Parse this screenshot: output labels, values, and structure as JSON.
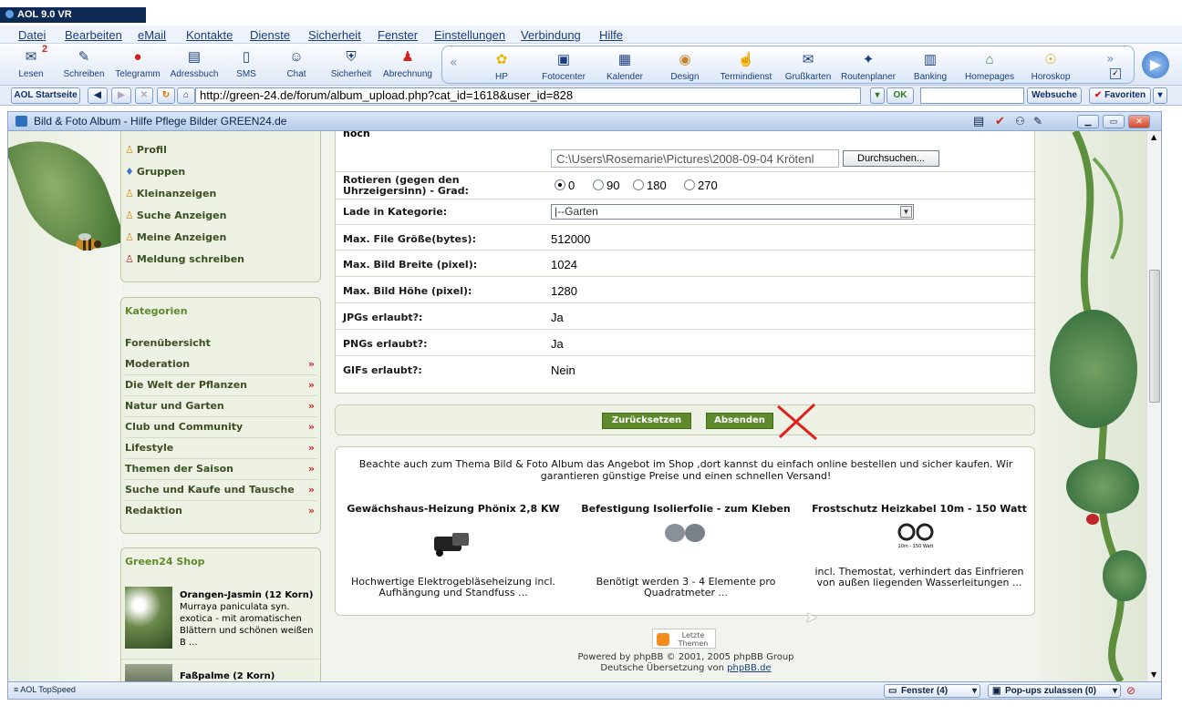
{
  "app_title": "AOL 9.0 VR",
  "menu": [
    "Datei",
    "Bearbeiten",
    "eMail",
    "Kontakte",
    "Dienste",
    "Sicherheit",
    "Fenster",
    "Einstellungen",
    "Verbindung",
    "Hilfe"
  ],
  "mail_badge": "2",
  "toolbar_left": [
    {
      "label": "Lesen",
      "icon": "mail-read-icon"
    },
    {
      "label": "Schreiben",
      "icon": "write-icon"
    },
    {
      "label": "Telegramm",
      "icon": "aim-icon"
    },
    {
      "label": "Adressbuch",
      "icon": "addressbook-icon"
    },
    {
      "label": "SMS",
      "icon": "phone-icon"
    },
    {
      "label": "Chat",
      "icon": "chat-icon"
    },
    {
      "label": "Sicherheit",
      "icon": "shield-icon"
    },
    {
      "label": "Abrechnung",
      "icon": "billing-icon"
    }
  ],
  "toolbar_right": [
    {
      "label": "HP",
      "icon": "flower-icon"
    },
    {
      "label": "Fotocenter",
      "icon": "photo-icon"
    },
    {
      "label": "Kalender",
      "icon": "calendar-icon"
    },
    {
      "label": "Design",
      "icon": "palette-icon"
    },
    {
      "label": "Termindienst",
      "icon": "hand-icon"
    },
    {
      "label": "Grußkarten",
      "icon": "card-icon"
    },
    {
      "label": "Routenplaner",
      "icon": "compass-icon"
    },
    {
      "label": "Banking",
      "icon": "bank-icon"
    },
    {
      "label": "Homepages",
      "icon": "house-icon"
    },
    {
      "label": "Horoskop",
      "icon": "horoscope-icon"
    }
  ],
  "address": {
    "home_label": "AOL Startseite",
    "url": "http://green-24.de/forum/album_upload.php?cat_id=1618&user_id=828",
    "ok_label": "OK",
    "search_label": "Websuche",
    "favorites_label": "Favoriten"
  },
  "window_title": "Bild & Foto Album - Hilfe Pflege Bilder GREEN24.de",
  "sidebar_top": [
    "Profil",
    "Gruppen",
    "Kleinanzeigen",
    "Suche Anzeigen",
    "Meine Anzeigen",
    "Meldung schreiben"
  ],
  "categories": {
    "heading": "Kategorien",
    "overview": "Forenübersicht",
    "items": [
      "Moderation",
      "Die Welt der Pflanzen",
      "Natur und Garten",
      "Club und Community",
      "Lifestyle",
      "Themen der Saison",
      "Suche und Kaufe und Tausche",
      "Redaktion"
    ]
  },
  "shop": {
    "heading": "Green24 Shop",
    "item1_title": "Orangen-Jasmin (12 Korn)",
    "item1_desc_1": "Murraya paniculata syn.",
    "item1_desc_2": "exotica - mit aromatischen",
    "item1_desc_3": "Blättern und schönen weißen",
    "item1_desc_4": "B ...",
    "item2_title": "Faßpalme (2 Korn)"
  },
  "form": {
    "cut_label": "hoch",
    "file_value": "C:\\Users\\Rosemarie\\Pictures\\2008-09-04 Krötenl",
    "browse_label": "Durchsuchen...",
    "rotate_label": "Rotieren (gegen den Uhrzeigersinn) - Grad:",
    "rotate_options": [
      "0",
      "90",
      "180",
      "270"
    ],
    "category_label": "Lade in Kategorie:",
    "category_value": "|--Garten",
    "rows": [
      {
        "label": "Max. File Größe(bytes):",
        "value": "512000"
      },
      {
        "label": "Max. Bild Breite (pixel):",
        "value": "1024"
      },
      {
        "label": "Max. Bild Höhe (pixel):",
        "value": "1280"
      },
      {
        "label": "JPGs erlaubt?:",
        "value": "Ja"
      },
      {
        "label": "PNGs erlaubt?:",
        "value": "Ja"
      },
      {
        "label": "GIFs erlaubt?:",
        "value": "Nein"
      }
    ],
    "reset_label": "Zurücksetzen",
    "submit_label": "Absenden"
  },
  "promo": {
    "intro_1": "Beachte auch zum Thema Bild & Foto Album das Angebot im Shop ,dort kannst du einfach online bestellen und sicher kaufen. Wir",
    "intro_2": "garantieren günstige Preise und einen schnellen Versand!",
    "products": [
      {
        "title": "Gewächshaus-Heizung Phönix 2,8 KW",
        "desc_1": "Hochwertige Elektrogebläseheizung incl.",
        "desc_2": "Aufhängung und Standfuss ..."
      },
      {
        "title": "Befestigung Isolierfolie - zum Kleben",
        "desc_1": "Benötigt werden 3 - 4 Elemente pro",
        "desc_2": "Quadratmeter ..."
      },
      {
        "title": "Frostschutz Heizkabel 10m - 150 Watt",
        "desc_1": "incl. Themostat, verhindert das Einfrieren",
        "desc_2": "von außen liegenden Wasserleitungen ...",
        "img_caption": "10m - 150 Watt"
      }
    ]
  },
  "footer": {
    "rss_1": "Letzte",
    "rss_2": "Themen",
    "powered": "Powered by phpBB © 2001, 2005 phpBB Group",
    "translation_prefix": "Deutsche Übersetzung von ",
    "translation_link": "phpBB.de"
  },
  "status": {
    "topspeed": "AOL TopSpeed",
    "windows": "Fenster (4)",
    "popups": "Pop-ups zulassen (0)"
  },
  "colors": {
    "accent_green": "#5f8a2c",
    "aol_blue": "#1a3e80",
    "chevron_red": "#c0262d",
    "annotation_red": "#e0201c"
  }
}
